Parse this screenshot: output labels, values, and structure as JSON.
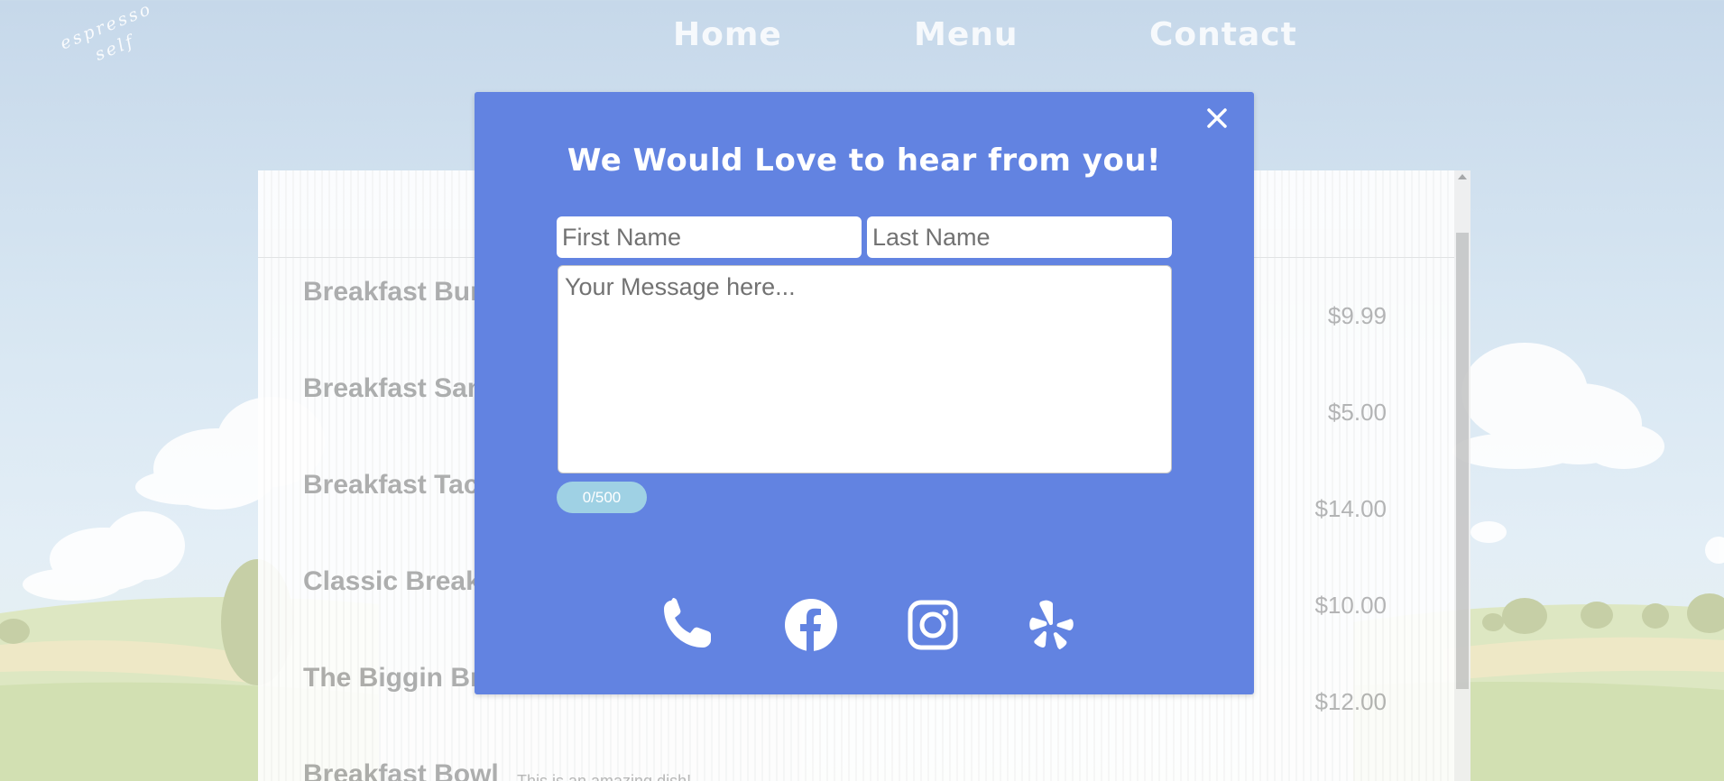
{
  "logo": {
    "line1": "espresso",
    "line2": "self"
  },
  "nav": {
    "home": "Home",
    "menu": "Menu",
    "contact": "Contact"
  },
  "menu_items": [
    {
      "name": "Breakfast Burrito",
      "price": "$9.99"
    },
    {
      "name": "Breakfast Sandwich",
      "price": "$5.00"
    },
    {
      "name": "Breakfast Tacos",
      "price": "$14.00"
    },
    {
      "name": "Classic Breakfast",
      "price": "$10.00"
    },
    {
      "name": "The Biggin Breakfast",
      "price": "$12.00"
    },
    {
      "name": "Breakfast Bowl",
      "description": "This is an amazing dish!"
    }
  ],
  "modal": {
    "title": "We Would Love to hear from you!",
    "first_name_placeholder": "First Name",
    "last_name_placeholder": "Last Name",
    "message_placeholder": "Your Message here...",
    "char_count": "0/500",
    "icons": [
      "close-icon",
      "phone-icon",
      "facebook-icon",
      "instagram-icon",
      "yelp-icon"
    ]
  },
  "colors": {
    "modal_bg": "#6283e1",
    "char_badge": "#9fd1e4",
    "sky_top": "#c6d8ea",
    "grass": "#dce8c0"
  }
}
